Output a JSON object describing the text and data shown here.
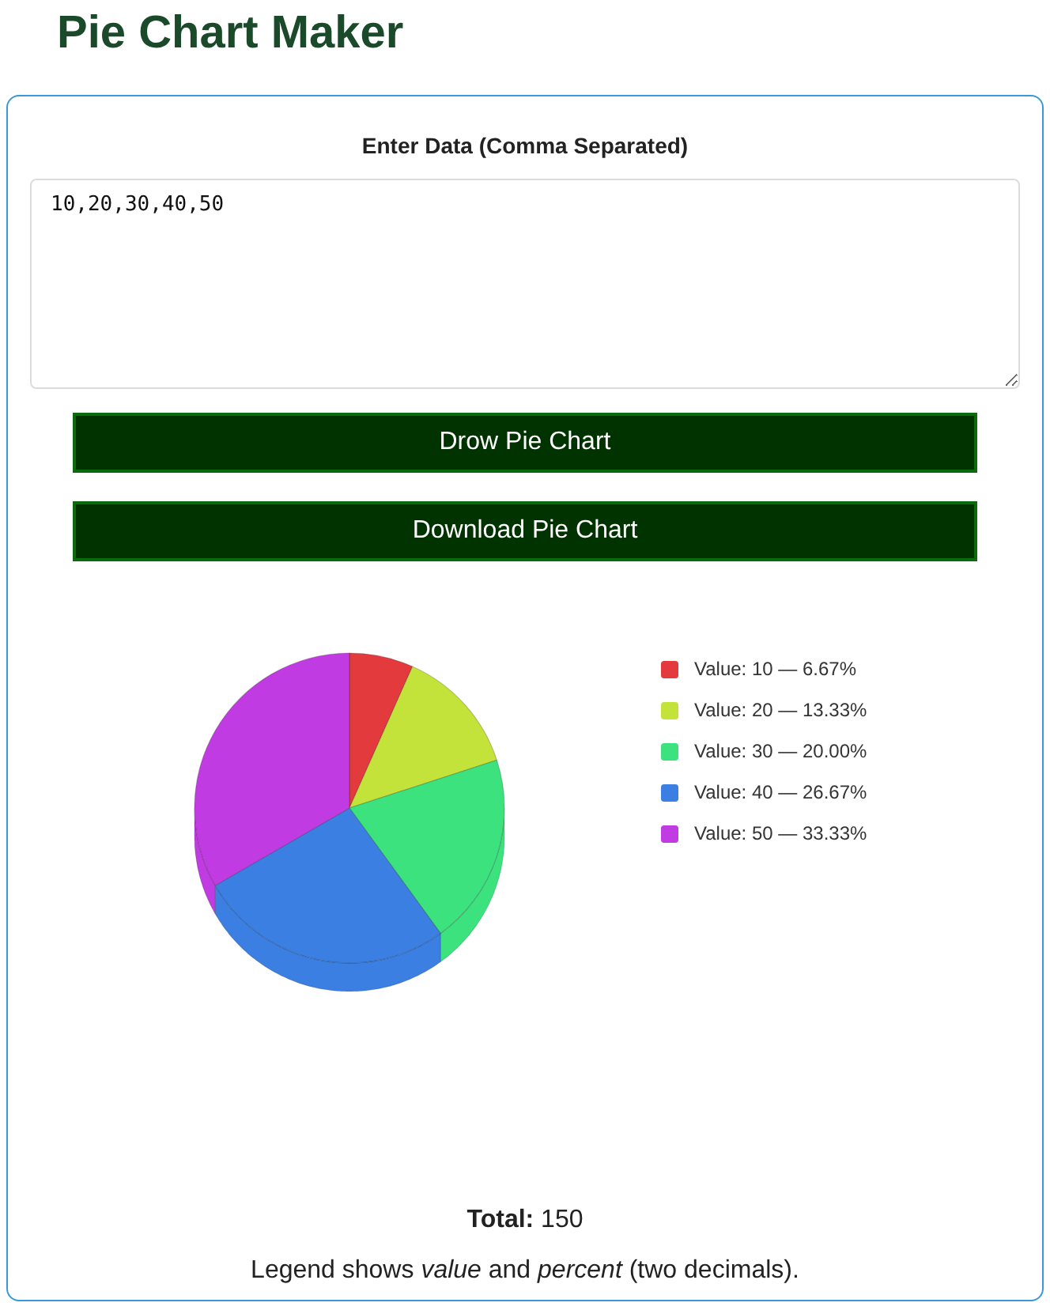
{
  "title": "Pie Chart Maker",
  "input": {
    "label": "Enter Data (Comma Separated)",
    "value": "10,20,30,40,50"
  },
  "buttons": [
    "Drow Pie Chart",
    "Download Pie Chart"
  ],
  "chart_data": {
    "type": "pie",
    "categories": [
      "Value: 10 — 6.67%",
      "Value: 20 — 13.33%",
      "Value: 30 — 20.00%",
      "Value: 40 — 26.67%",
      "Value: 50 — 33.33%"
    ],
    "values": [
      10,
      20,
      30,
      40,
      50
    ],
    "colors": [
      "#e33b3d",
      "#c4e33a",
      "#3be27d",
      "#3b7fe2",
      "#c03be2"
    ],
    "legend": "right"
  },
  "total": "**Total:** 150",
  "note": "Legend shows *value* and *percent* (two decimals)."
}
